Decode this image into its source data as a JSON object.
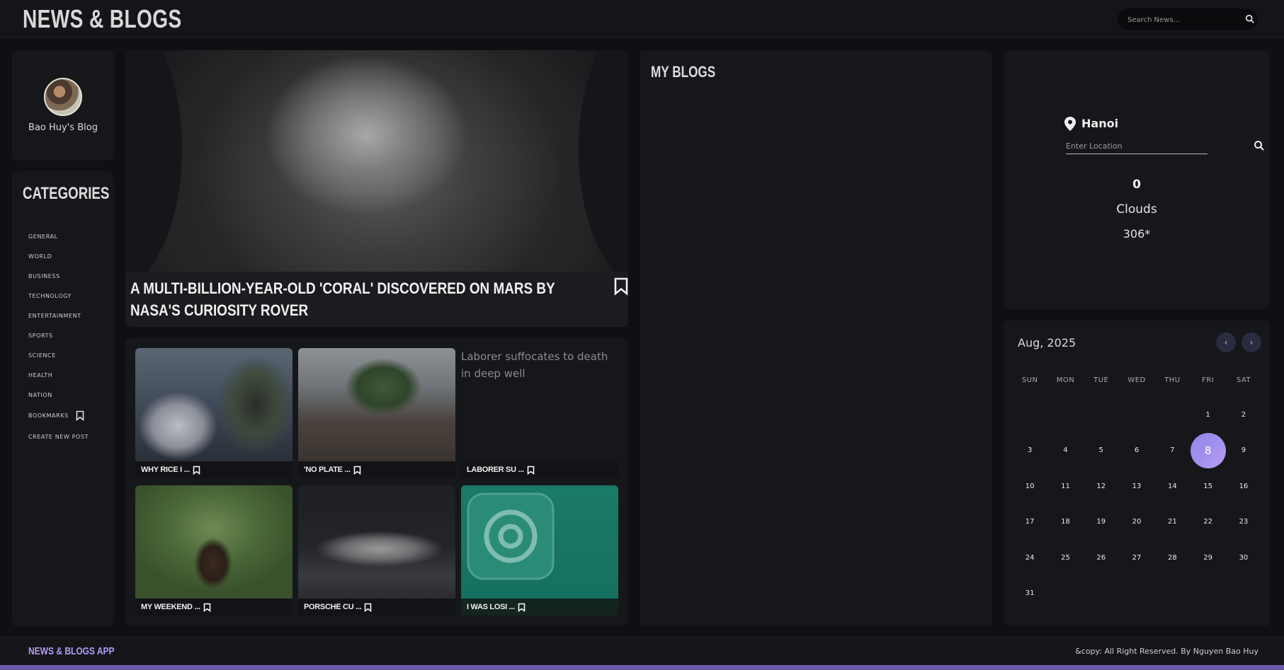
{
  "header": {
    "title": "NEWS & BLOGS",
    "search_placeholder": "Search News..."
  },
  "profile": {
    "name": "Bao Huy's Blog"
  },
  "categories": {
    "title": "CATEGORIES",
    "items": [
      {
        "label": "GENERAL"
      },
      {
        "label": "WORLD"
      },
      {
        "label": "BUSINESS"
      },
      {
        "label": "TECHNOLOGY"
      },
      {
        "label": "ENTERTAINMENT"
      },
      {
        "label": "SPORTS"
      },
      {
        "label": "SCIENCE"
      },
      {
        "label": "HEALTH"
      },
      {
        "label": "NATION"
      },
      {
        "label": "BOOKMARKS"
      },
      {
        "label": "CREATE NEW POST"
      }
    ]
  },
  "hero": {
    "title": "A MULTI-BILLION-YEAR-OLD 'CORAL' DISCOVERED ON MARS BY NASA'S CURIOSITY ROVER"
  },
  "news": [
    {
      "title": "WHY RICE I ..."
    },
    {
      "title": "'NO PLATE ..."
    },
    {
      "title": "LABORER SU ...",
      "image_alt": "Laborer suffocates to death in deep well"
    },
    {
      "title": "MY WEEKEND ..."
    },
    {
      "title": "PORSCHE CU ..."
    },
    {
      "title": "I WAS LOSI ..."
    }
  ],
  "blogs": {
    "title": "MY BLOGS"
  },
  "weather": {
    "city": "Hanoi",
    "location_placeholder": "Enter Location",
    "temperature": "0",
    "description": "Clouds",
    "extra": "306*"
  },
  "calendar": {
    "month_label": "Aug,  2025",
    "prev": "‹",
    "next": "›",
    "weekdays": [
      "SUN",
      "MON",
      "TUE",
      "WED",
      "THU",
      "FRI",
      "SAT"
    ],
    "leading_blanks": 5,
    "days_in_month": 31,
    "today": 8
  },
  "footer": {
    "brand": "NEWS & BLOGS APP",
    "copyright": "&copy: All Right Reserved. By Nguyen Bao Huy"
  },
  "colors": {
    "accent": "#b39bf5",
    "background": "#0f1013",
    "panel": "#16171b"
  }
}
